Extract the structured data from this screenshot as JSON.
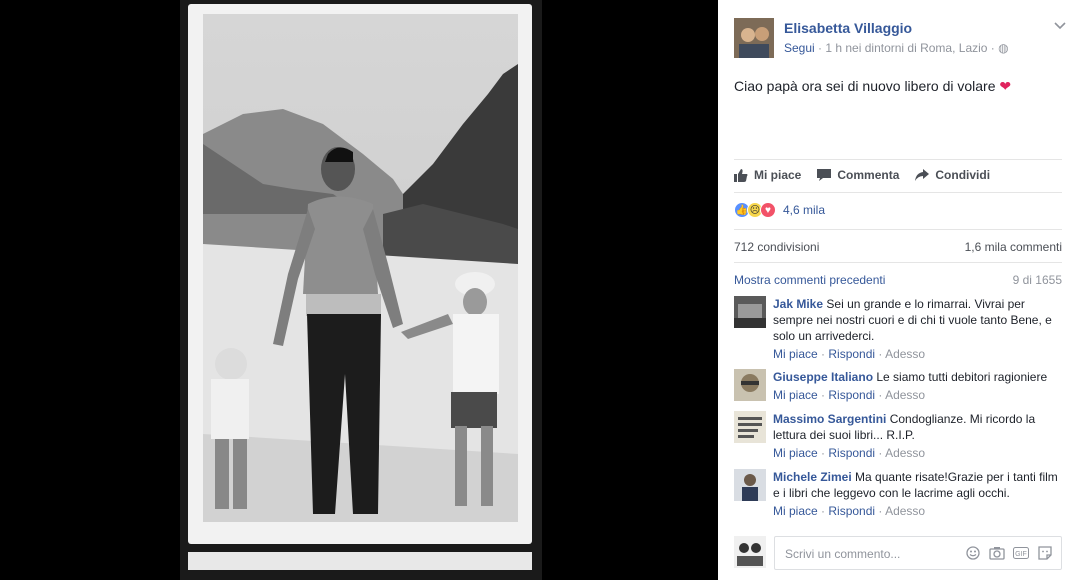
{
  "post": {
    "author": "Elisabetta Villaggio",
    "follow_label": "Segui",
    "meta": " · 1 h nei dintorni di Roma, Lazio · ",
    "text": "Ciao papà ora sei di nuovo libero di volare",
    "emoji": "❤"
  },
  "actions": {
    "like": "Mi piace",
    "comment": "Commenta",
    "share": "Condividi"
  },
  "reactions": {
    "count": "4,6 mila"
  },
  "stats": {
    "shares": "712 condivisioni",
    "comments": "1,6 mila commenti"
  },
  "comments_nav": {
    "previous": "Mostra commenti precedenti",
    "pager": "9 di 1655"
  },
  "comments": [
    {
      "name": "Jak Mike",
      "text": "Sei un grande e lo rimarrai. Vivrai per sempre nei nostri cuori e di chi ti vuole tanto Bene, e solo un arrivederci.",
      "like": "Mi piace",
      "reply": "Rispondi",
      "time": "Adesso"
    },
    {
      "name": "Giuseppe Italiano",
      "text": "Le siamo tutti debitori ragioniere",
      "like": "Mi piace",
      "reply": "Rispondi",
      "time": "Adesso"
    },
    {
      "name": "Massimo Sargentini",
      "text": "Condoglianze. Mi ricordo la lettura dei suoi libri... R.I.P.",
      "like": "Mi piace",
      "reply": "Rispondi",
      "time": "Adesso"
    },
    {
      "name": "Michele Zimei",
      "text": "Ma quante risate!Grazie per i tanti film e i libri che leggevo con le lacrime agli occhi.",
      "like": "Mi piace",
      "reply": "Rispondi",
      "time": "Adesso"
    }
  ],
  "composer": {
    "placeholder": "Scrivi un commento..."
  },
  "colors": {
    "link": "#365899",
    "muted": "#90949c"
  }
}
